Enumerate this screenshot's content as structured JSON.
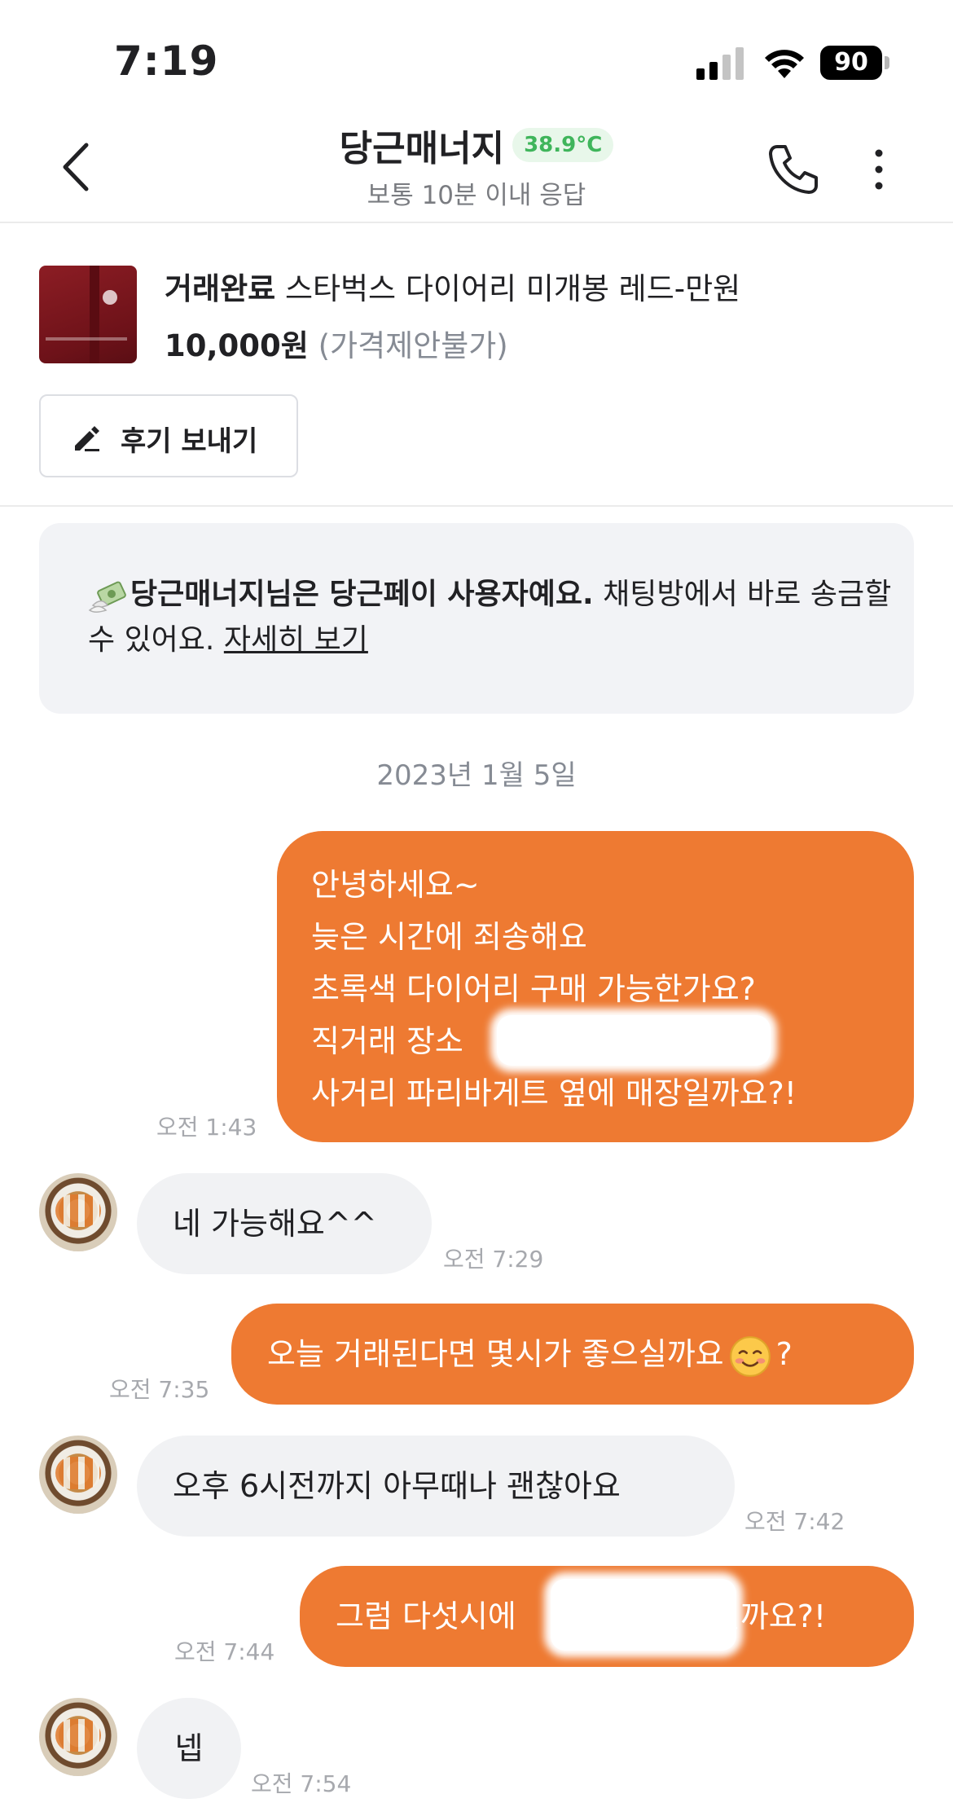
{
  "status_bar": {
    "time": "7:19",
    "battery": "90",
    "icons": [
      "cellular-signal-icon",
      "wifi-icon",
      "battery-icon"
    ]
  },
  "header": {
    "title": "당근매너지",
    "temperature": "38.9°C",
    "subtitle": "보통 10분 이내 응답",
    "icons": [
      "back-chevron-icon",
      "phone-icon",
      "more-vertical-icon"
    ],
    "temperature_color": "#3fb55b"
  },
  "product": {
    "status": "거래완료",
    "title": "스타벅스 다이어리 미개봉 레드-만원",
    "price": "10,000원",
    "nego": "(가격제안불가)",
    "review_button": "후기 보내기"
  },
  "notice": {
    "bold": "당근매너지님은 당근페이 사용자예요.",
    "text": "채팅방에서 바로 송금할 수 있어요.",
    "link": "자세히 보기"
  },
  "date_divider": "2023년 1월 5일",
  "messages": [
    {
      "direction": "out",
      "lines": [
        "안녕하세요~",
        "늦은 시간에 죄송해요",
        "초록색 다이어리 구매 가능한가요?",
        "직거래 장소",
        "사거리 파리바게트 옆에 매장일까요?!"
      ],
      "time": "오전 1:43"
    },
    {
      "direction": "in",
      "text": "네 가능해요^^",
      "time": "오전 7:29"
    },
    {
      "direction": "out",
      "text": "오늘 거래된다면 몇시가 좋으실까요",
      "text_after": "?",
      "emoji": "☺️",
      "time": "오전 7:35"
    },
    {
      "direction": "in",
      "text": "오후 6시전까지 아무때나 괜찮아요",
      "time": "오전 7:42"
    },
    {
      "direction": "out",
      "text": "그럼 다섯시에",
      "text_after": "뵐까요?!",
      "time": "오전 7:44"
    },
    {
      "direction": "in",
      "text": "넵",
      "time": "오전 7:54"
    }
  ],
  "colors": {
    "outgoing_bubble": "#ee7a32",
    "incoming_bubble": "#f1f2f4",
    "notice_bg": "#f2f3f6"
  }
}
